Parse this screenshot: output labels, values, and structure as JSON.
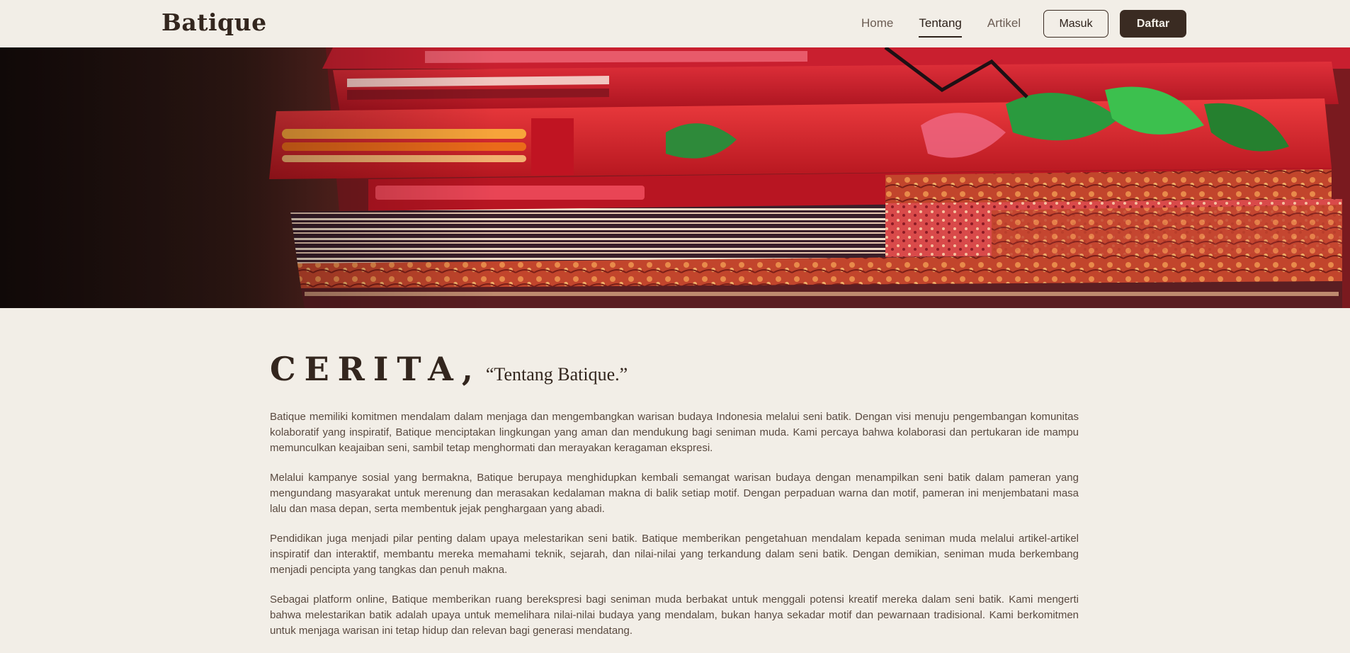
{
  "brand": "Batique",
  "nav": {
    "links": [
      {
        "label": "Home",
        "active": false
      },
      {
        "label": "Tentang",
        "active": true
      },
      {
        "label": "Artikel",
        "active": false
      }
    ],
    "login": "Masuk",
    "register": "Daftar"
  },
  "hero": {
    "icon": "batik-fabric-image"
  },
  "story": {
    "title": "CERITA,",
    "subtitle": "“Tentang Batique.”",
    "paragraphs": [
      "Batique memiliki komitmen mendalam dalam menjaga dan mengembangkan warisan budaya Indonesia melalui seni batik. Dengan visi menuju pengembangan komunitas kolaboratif yang inspiratif, Batique menciptakan lingkungan yang aman dan mendukung bagi seniman muda. Kami percaya bahwa kolaborasi dan pertukaran ide mampu memunculkan keajaiban seni, sambil tetap menghormati dan merayakan keragaman ekspresi.",
      "Melalui kampanye sosial yang bermakna, Batique berupaya menghidupkan kembali semangat warisan budaya dengan menampilkan seni batik dalam pameran yang mengundang masyarakat untuk merenung dan merasakan kedalaman makna di balik setiap motif. Dengan perpaduan warna dan motif, pameran ini menjembatani masa lalu dan masa depan, serta membentuk jejak penghargaan yang abadi.",
      "Pendidikan juga menjadi pilar penting dalam upaya melestarikan seni batik. Batique memberikan pengetahuan mendalam kepada seniman muda melalui artikel-artikel inspiratif dan interaktif, membantu mereka memahami teknik, sejarah, dan nilai-nilai yang terkandung dalam seni batik. Dengan demikian, seniman muda berkembang menjadi pencipta yang tangkas dan penuh makna.",
      "Sebagai platform online, Batique memberikan ruang berekspresi bagi seniman muda berbakat untuk menggali potensi kreatif mereka dalam seni batik. Kami mengerti bahwa melestarikan batik adalah upaya untuk memelihara nilai-nilai budaya yang mendalam, bukan hanya sekadar motif dan pewarnaan tradisional. Kami berkomitmen untuk menjaga warisan ini tetap hidup dan relevan bagi generasi mendatang."
    ]
  },
  "colors": {
    "background": "#f2eee7",
    "primary": "#3a2b22"
  }
}
